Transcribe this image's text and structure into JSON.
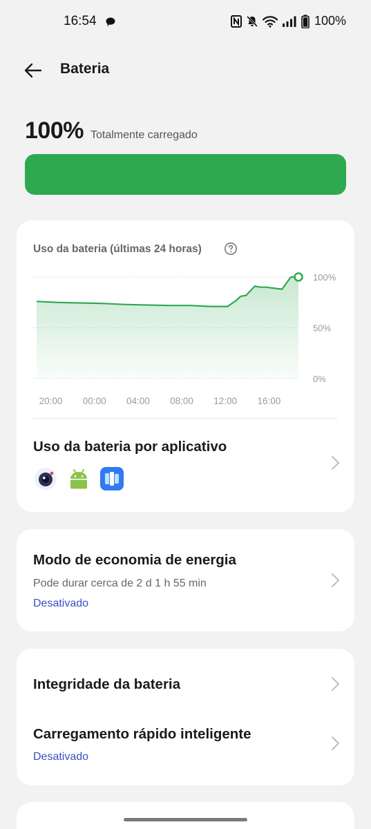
{
  "status_bar": {
    "time": "16:54",
    "battery_percent": "100%",
    "icons": [
      "chat-bubble-icon",
      "nfc-icon",
      "bell-muted-icon",
      "wifi-icon",
      "signal-icon",
      "battery-icon"
    ]
  },
  "header": {
    "back_icon": "arrow-left-icon",
    "title": "Bateria"
  },
  "battery": {
    "level_label": "100%",
    "level_fraction": 1.0,
    "status": "Totalmente carregado",
    "fill_color": "#2ea94f"
  },
  "usage": {
    "title": "Uso da bateria (últimas 24 horas)",
    "help_icon": "question-circle-icon",
    "per_app_title": "Uso da bateria por aplicativo",
    "apps": [
      {
        "icon": "camera-app-icon"
      },
      {
        "icon": "android-app-icon"
      },
      {
        "icon": "files-app-icon"
      }
    ]
  },
  "chart_data": {
    "type": "area",
    "x_tick_labels": [
      "20:00",
      "00:00",
      "04:00",
      "08:00",
      "12:00",
      "16:00"
    ],
    "y_tick_labels": [
      "100%",
      "50%",
      "0%"
    ],
    "ylim": [
      0,
      100
    ],
    "x_hours": [
      0,
      2,
      6,
      8,
      12,
      14,
      16,
      17.5,
      18.3,
      18.7,
      19.2,
      20,
      20.5,
      21,
      22.5,
      23.3,
      24
    ],
    "y_values": [
      76,
      75,
      74,
      73,
      72,
      72,
      71,
      71,
      77,
      81,
      82,
      91,
      90,
      90,
      88,
      100,
      100
    ],
    "x_axis_hour_at_20_00": 1.3,
    "line_color": "#2ea94f",
    "grid": true
  },
  "saver": {
    "title": "Modo de economia de energia",
    "subtitle": "Pode durar cerca de 2 d 1 h 55 min",
    "state": "Desativado"
  },
  "health": {
    "title": "Integridade da bateria"
  },
  "fast_charge": {
    "title": "Carregamento rápido inteligente",
    "state": "Desativado"
  }
}
